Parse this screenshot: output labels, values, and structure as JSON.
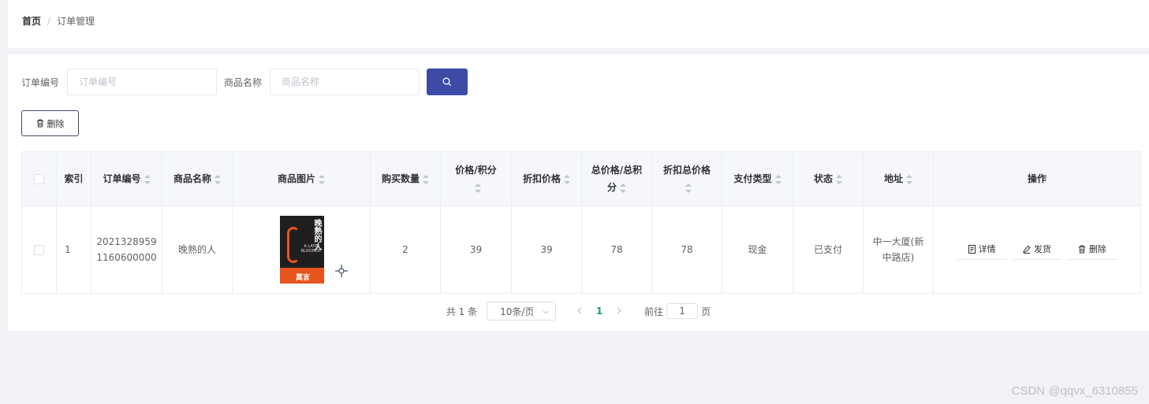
{
  "breadcrumb": {
    "home": "首页",
    "separator": "/",
    "current": "订单管理"
  },
  "search": {
    "order_no_label": "订单编号",
    "order_no_placeholder": "订单编号",
    "product_name_label": "商品名称",
    "product_name_placeholder": "商品名称",
    "button_icon": "search-icon"
  },
  "toolbar": {
    "delete_label": "删除",
    "delete_icon": "trash-icon"
  },
  "table": {
    "headers": {
      "index": "索引",
      "order_no": "订单编号",
      "product_name": "商品名称",
      "product_image": "商品图片",
      "quantity": "购买数量",
      "price": "价格/积分",
      "discount_price": "折扣价格",
      "total_price": "总价格/总积分",
      "discount_total": "折扣总价格",
      "payment_type": "支付类型",
      "status": "状态",
      "address": "地址",
      "actions": "操作"
    },
    "rows": [
      {
        "index": "1",
        "order_no": "20213289591160600000",
        "product_name": "晚熟的人",
        "product_image": {
          "title": "晚熟的人",
          "subtitle": "A LATE BLOOMER",
          "author": "莫言"
        },
        "quantity": "2",
        "price": "39",
        "discount_price": "39",
        "total_price": "78",
        "discount_total": "78",
        "payment_type": "现金",
        "status": "已支付",
        "address": "中一大厦(新中路店)",
        "actions": {
          "detail": "详情",
          "ship": "发货",
          "delete": "删除"
        }
      }
    ]
  },
  "pagination": {
    "total": "共 1 条",
    "page_size": "10条/页",
    "current_page": "1",
    "goto_prefix": "前往",
    "goto_value": "1",
    "goto_suffix": "页"
  },
  "watermark": "CSDN @qqvx_6310855",
  "colors": {
    "primary": "#3d4aa6",
    "active_page": "#16a085"
  }
}
